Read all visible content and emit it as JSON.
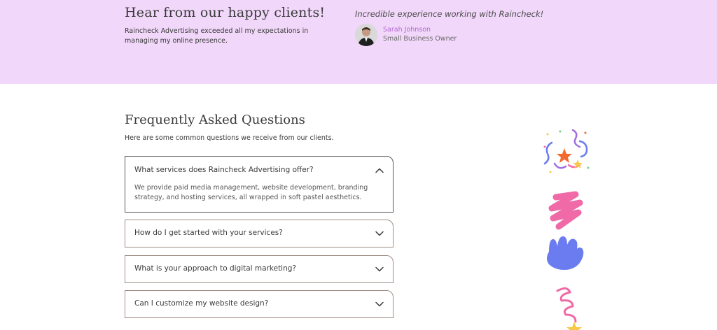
{
  "testimonial": {
    "title": "Hear from our happy clients!",
    "body": "Raincheck Advertising exceeded all my expectations in managing my online presence.",
    "quote": "Incredible experience working with Raincheck!",
    "author_name": "Sarah Johnson",
    "author_role": "Small Business Owner"
  },
  "faq": {
    "title": "Frequently Asked Questions",
    "subtitle": "Here are some common questions we receive from our clients.",
    "items": [
      {
        "question": "What services does Raincheck Advertising offer?",
        "answer": "We provide paid media management, website development, branding strategy, and hosting services, all wrapped in soft pastel aesthetics.",
        "expanded": true
      },
      {
        "question": "How do I get started with your services?",
        "expanded": false
      },
      {
        "question": "What is your approach to digital marketing?",
        "expanded": false
      },
      {
        "question": "Can I customize my website design?",
        "expanded": false
      }
    ]
  },
  "colors": {
    "testimonial_bg": "#f1d7f9",
    "author_name": "#b06ad1",
    "pink": "#f06aa8",
    "blue": "#6a7cf0",
    "orange": "#f26a2e",
    "yellow": "#f7c948"
  },
  "icons": [
    "chevron-up-icon",
    "chevron-down-icon",
    "avatar"
  ]
}
